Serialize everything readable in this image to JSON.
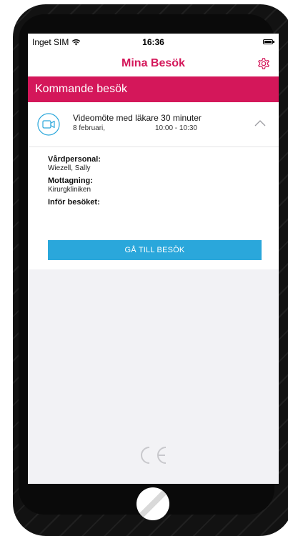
{
  "status_bar": {
    "carrier": "Inget SIM",
    "time": "16:36"
  },
  "navbar": {
    "title": "Mina Besök",
    "settings_icon": "gear-icon"
  },
  "section": {
    "title": "Kommande besök"
  },
  "visit": {
    "title": "Videomöte med läkare 30 minuter",
    "date": "8 februari,",
    "time": "10:00 - 10:30",
    "icon": "video-camera-icon",
    "expanded": true
  },
  "details": {
    "staff_label": "Vårdperson​al:",
    "staff_value": "Wiezell, Sally",
    "clinic_label": "Mottagning:",
    "clinic_value": "Kirurgkliniken",
    "prep_label": "Inför besöket:"
  },
  "actions": {
    "go_label": "GÅ TILL BESÖK"
  },
  "colors": {
    "accent": "#d4175a",
    "button": "#2aa7db",
    "background": "#f2f2f5"
  }
}
